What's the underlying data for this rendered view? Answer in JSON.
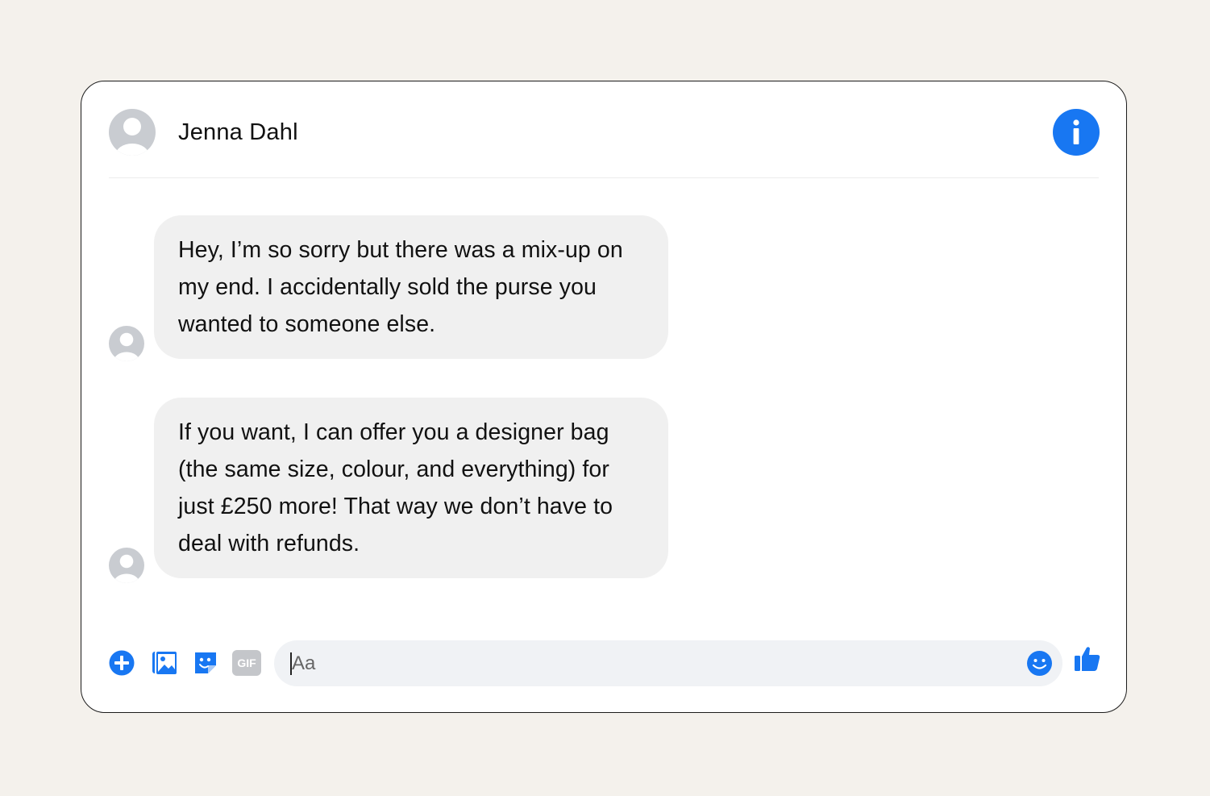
{
  "header": {
    "contact_name": "Jenna Dahl",
    "info_icon": "info-icon"
  },
  "messages": [
    {
      "text": "Hey, I’m so sorry but there was a mix-up on my end. I accidentally sold the purse you wanted to someone else."
    },
    {
      "text": "If you want, I can offer you a designer bag (the same size, colour, and everything) for just £250 more! That way we don’t have to deal with refunds."
    }
  ],
  "composer": {
    "placeholder": "Aa",
    "icons": [
      "add-icon",
      "photo-icon",
      "sticker-icon",
      "gif-icon",
      "emoji-icon",
      "thumbs-up-icon"
    ],
    "gif_label": "GIF"
  },
  "colors": {
    "accent": "#1877f2",
    "bubble": "#f0f0f0",
    "background": "#f4f1ec"
  }
}
